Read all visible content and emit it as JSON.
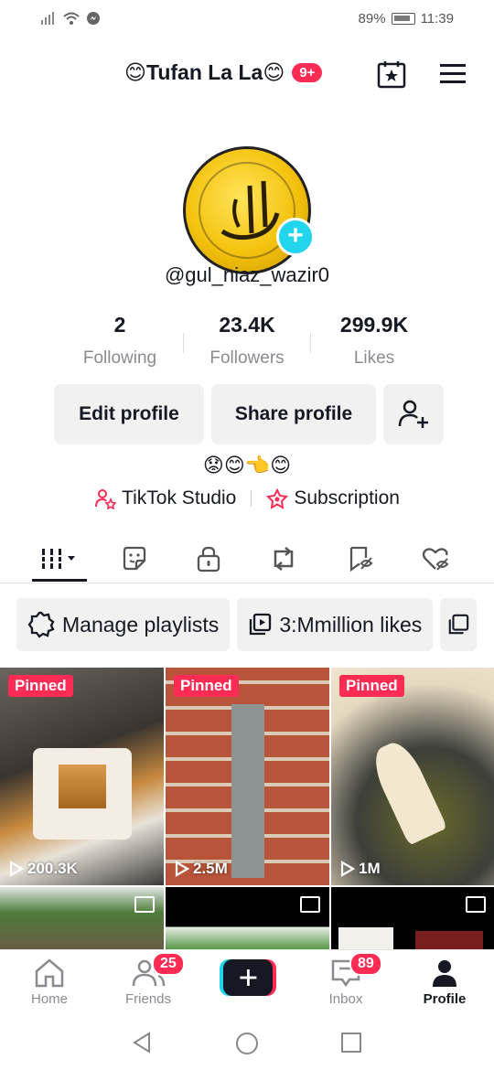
{
  "status_bar": {
    "battery": "89%",
    "time": "11:39"
  },
  "header": {
    "display_name": "😊Tufan La La😊",
    "notification_count": "9+"
  },
  "profile": {
    "handle": "@gul_niaz_wazir0",
    "stats": [
      {
        "value": "2",
        "label": "Following"
      },
      {
        "value": "23.4K",
        "label": "Followers"
      },
      {
        "value": "299.9K",
        "label": "Likes"
      }
    ],
    "edit_label": "Edit profile",
    "share_label": "Share profile",
    "bio": "😟😊👈😊",
    "studio_label": "TikTok Studio",
    "subscription_label": "Subscription"
  },
  "playlists": [
    {
      "label": "Manage playlists"
    },
    {
      "label": "3:Mmillion likes"
    }
  ],
  "videos": [
    {
      "pinned": "Pinned",
      "views": "200.3K"
    },
    {
      "pinned": "Pinned",
      "views": "2.5M"
    },
    {
      "pinned": "Pinned",
      "views": "1M"
    }
  ],
  "bottom_nav": {
    "home": "Home",
    "friends": "Friends",
    "friends_badge": "25",
    "inbox": "Inbox",
    "inbox_badge": "89",
    "profile": "Profile"
  },
  "colors": {
    "accent": "#fe2c55",
    "cyan": "#20d5ec",
    "chip_bg": "#f1f1f2"
  },
  "icons": [
    "wifi-icon",
    "messenger-icon",
    "battery-icon",
    "calendar-star-icon",
    "menu-icon",
    "add-icon",
    "add-friend-icon",
    "tiktok-studio-icon",
    "subscription-icon",
    "videos-grid-icon",
    "stickers-icon",
    "lock-icon",
    "repost-icon",
    "favorites-icon",
    "liked-icon",
    "playlist-settings-icon",
    "playlist-icon",
    "play-icon",
    "photo-icon",
    "home-icon",
    "friends-icon",
    "create-icon",
    "inbox-icon",
    "profile-icon",
    "back-icon",
    "home-circle-icon",
    "recents-icon"
  ]
}
